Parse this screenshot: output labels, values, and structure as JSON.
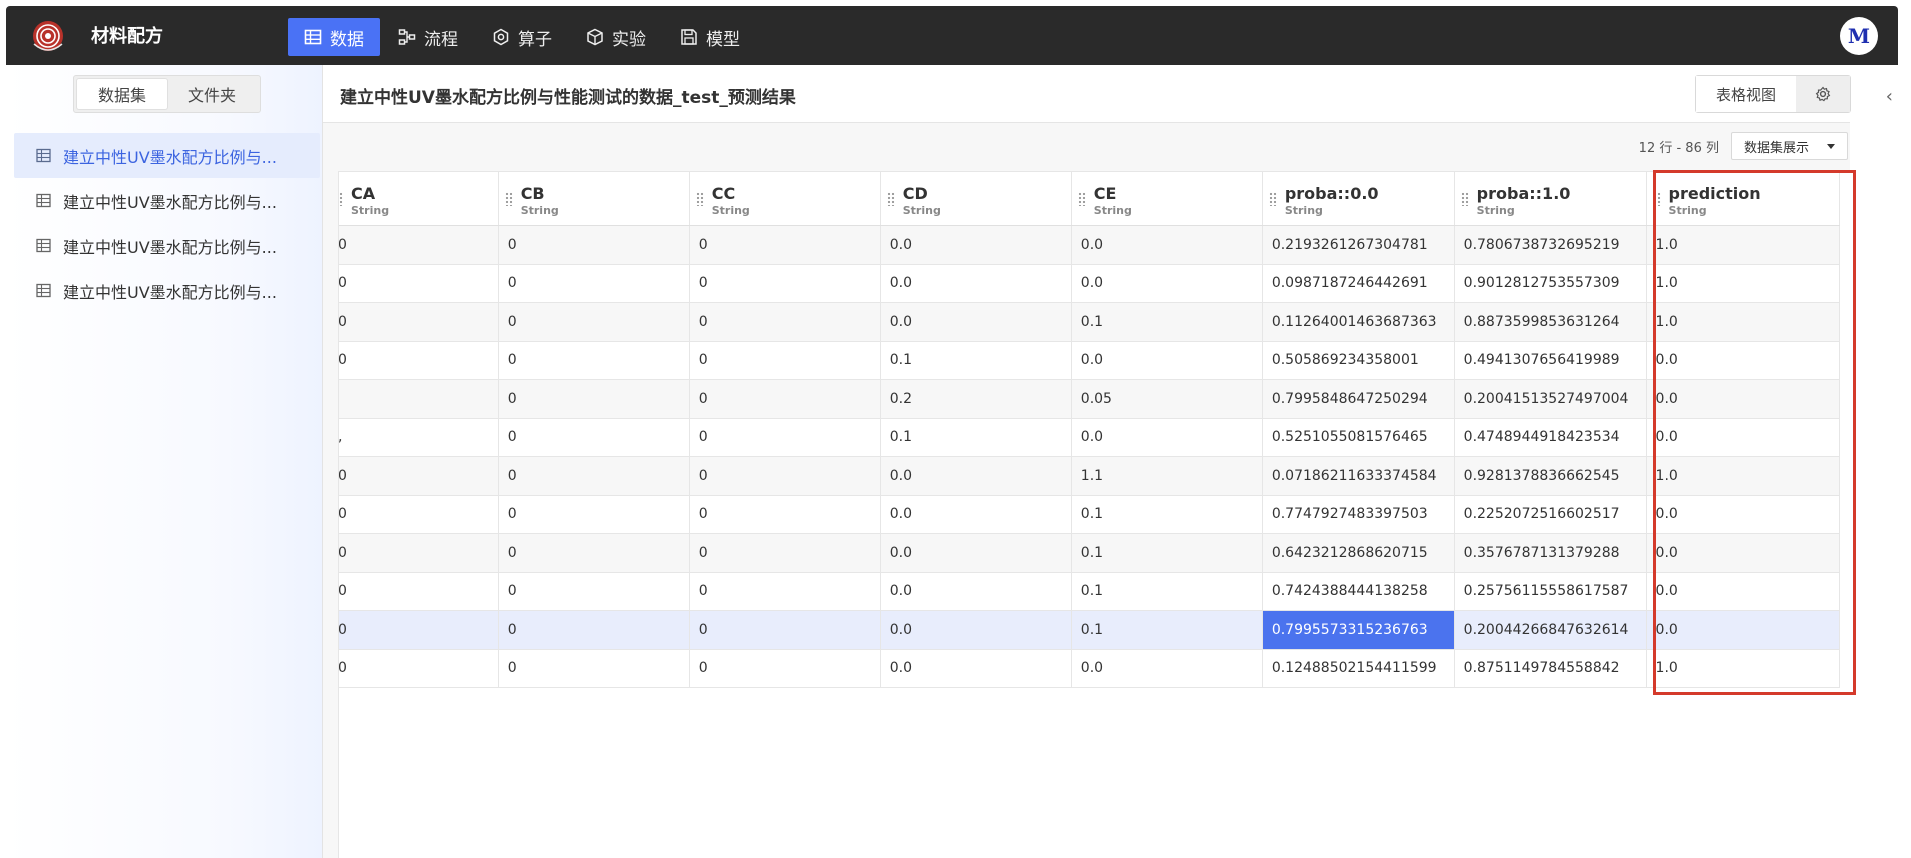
{
  "app": {
    "title": "材料配方",
    "avatar_letter": "M"
  },
  "nav": [
    {
      "label": "数据",
      "icon": "table-icon",
      "active": true
    },
    {
      "label": "流程",
      "icon": "flow-icon",
      "active": false
    },
    {
      "label": "算子",
      "icon": "operator-icon",
      "active": false
    },
    {
      "label": "实验",
      "icon": "cube-icon",
      "active": false
    },
    {
      "label": "模型",
      "icon": "save-icon",
      "active": false
    }
  ],
  "sidebar": {
    "tabs": [
      "数据集",
      "文件夹"
    ],
    "items": [
      {
        "label": "建立中性UV墨水配方比例与...",
        "selected": true
      },
      {
        "label": "建立中性UV墨水配方比例与...",
        "selected": false
      },
      {
        "label": "建立中性UV墨水配方比例与...",
        "selected": false
      },
      {
        "label": "建立中性UV墨水配方比例与...",
        "selected": false
      }
    ]
  },
  "main": {
    "title": "建立中性UV墨水配方比例与性能测试的数据_test_预测结果",
    "view_label": "表格视图",
    "count_text": "12 行 - 86 列",
    "dropdown_label": "数据集展示"
  },
  "table": {
    "columns": [
      {
        "name": "CA",
        "type": "String"
      },
      {
        "name": "CB",
        "type": "String"
      },
      {
        "name": "CC",
        "type": "String"
      },
      {
        "name": "CD",
        "type": "String"
      },
      {
        "name": "CE",
        "type": "String"
      },
      {
        "name": "proba::0.0",
        "type": "String"
      },
      {
        "name": "proba::1.0",
        "type": "String"
      },
      {
        "name": "prediction",
        "type": "String"
      }
    ],
    "rows": [
      [
        "0",
        "0",
        "0",
        "0.0",
        "0.0",
        "0.2193261267304781",
        "0.7806738732695219",
        "1.0"
      ],
      [
        "0",
        "0",
        "0",
        "0.0",
        "0.0",
        "0.0987187246442691",
        "0.9012812753557309",
        "1.0"
      ],
      [
        "0",
        "0",
        "0",
        "0.0",
        "0.1",
        "0.11264001463687363",
        "0.8873599853631264",
        "1.0"
      ],
      [
        "0",
        "0",
        "0",
        "0.1",
        "0.0",
        "0.505869234358001",
        "0.4941307656419989",
        "0.0"
      ],
      [
        "",
        "0",
        "0",
        "0.2",
        "0.05",
        "0.7995848647250294",
        "0.20041513527497004",
        "0.0"
      ],
      [
        ",",
        "0",
        "0",
        "0.1",
        "0.0",
        "0.5251055081576465",
        "0.4748944918423534",
        "0.0"
      ],
      [
        "0",
        "0",
        "0",
        "0.0",
        "1.1",
        "0.07186211633374584",
        "0.9281378836662545",
        "1.0"
      ],
      [
        "0",
        "0",
        "0",
        "0.0",
        "0.1",
        "0.7747927483397503",
        "0.2252072516602517",
        "0.0"
      ],
      [
        "0",
        "0",
        "0",
        "0.0",
        "0.1",
        "0.6423212868620715",
        "0.3576787131379288",
        "0.0"
      ],
      [
        "0",
        "0",
        "0",
        "0.0",
        "0.1",
        "0.7424388444138258",
        "0.25756115558617587",
        "0.0"
      ],
      [
        "0",
        "0",
        "0",
        "0.0",
        "0.1",
        "0.7995573315236763",
        "0.20044266847632614",
        "0.0"
      ],
      [
        "0",
        "0",
        "0",
        "0.0",
        "0.0",
        "0.12488502154411599",
        "0.8751149784558842",
        "1.0"
      ]
    ],
    "selected_row": 10,
    "selected_col": 5
  },
  "colors": {
    "accent": "#4a72f5",
    "highlight_box": "#d43a2b",
    "topbar": "#2a2a2a"
  }
}
